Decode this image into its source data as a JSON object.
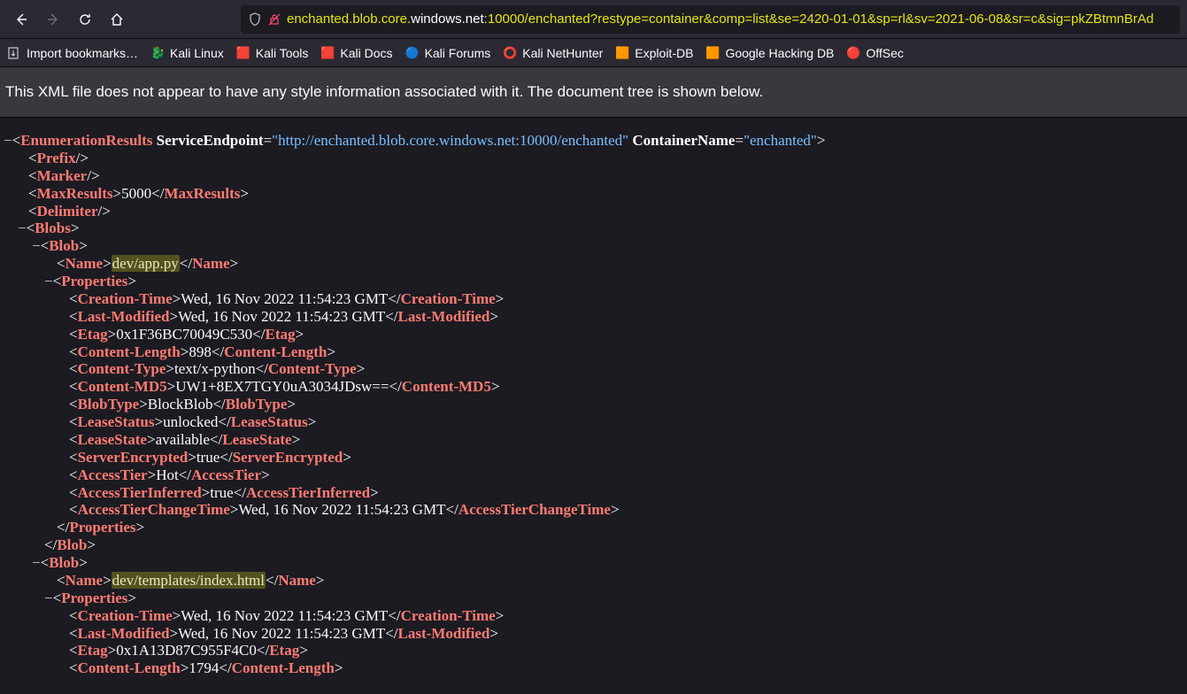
{
  "url": {
    "prefix": "enchanted.blob.core.",
    "main": "windows.net",
    "suffix": ":10000/enchanted?restype=container&comp=list&se=2420-01-01&sp=rl&sv=2021-06-08&sr=c&sig=pkZBtmnBrAd"
  },
  "bookmarks": {
    "import": "Import bookmarks…",
    "items": [
      "Kali Linux",
      "Kali Tools",
      "Kali Docs",
      "Kali Forums",
      "Kali NetHunter",
      "Exploit-DB",
      "Google Hacking DB",
      "OffSec"
    ]
  },
  "infobar": "This XML file does not appear to have any style information associated with it. The document tree is shown below.",
  "xml": {
    "root_tag": "EnumerationResults",
    "attr_se_name": "ServiceEndpoint",
    "attr_se_val": "\"http://enchanted.blob.core.windows.net:10000/enchanted\"",
    "attr_cn_name": "ContainerName",
    "attr_cn_val": "\"enchanted\"",
    "prefix": "Prefix",
    "marker": "Marker",
    "maxresults": "MaxResults",
    "maxresults_val": "5000",
    "delimiter": "Delimiter",
    "blobs": "Blobs",
    "blob": "Blob",
    "name": "Name",
    "properties": "Properties",
    "ctime": "Creation-Time",
    "lmod": "Last-Modified",
    "etag": "Etag",
    "clen": "Content-Length",
    "ctype": "Content-Type",
    "cmd5": "Content-MD5",
    "btype": "BlobType",
    "lstatus": "LeaseStatus",
    "lstate": "LeaseState",
    "senc": "ServerEncrypted",
    "atier": "AccessTier",
    "atierinf": "AccessTierInferred",
    "atierct": "AccessTierChangeTime",
    "blob1": {
      "name": "dev/app.py",
      "ctime": "Wed, 16 Nov 2022 11:54:23 GMT",
      "lmod": "Wed, 16 Nov 2022 11:54:23 GMT",
      "etag": "0x1F36BC70049C530",
      "clen": "898",
      "ctype": "text/x-python",
      "cmd5": "UW1+8EX7TGY0uA3034JDsw==",
      "btype": "BlockBlob",
      "lstatus": "unlocked",
      "lstate": "available",
      "senc": "true",
      "atier": "Hot",
      "atierinf": "true",
      "atierct": "Wed, 16 Nov 2022 11:54:23 GMT"
    },
    "blob2": {
      "name": "dev/templates/index.html",
      "ctime": "Wed, 16 Nov 2022 11:54:23 GMT",
      "lmod": "Wed, 16 Nov 2022 11:54:23 GMT",
      "etag": "0x1A13D87C955F4C0",
      "clen": "1794"
    }
  }
}
